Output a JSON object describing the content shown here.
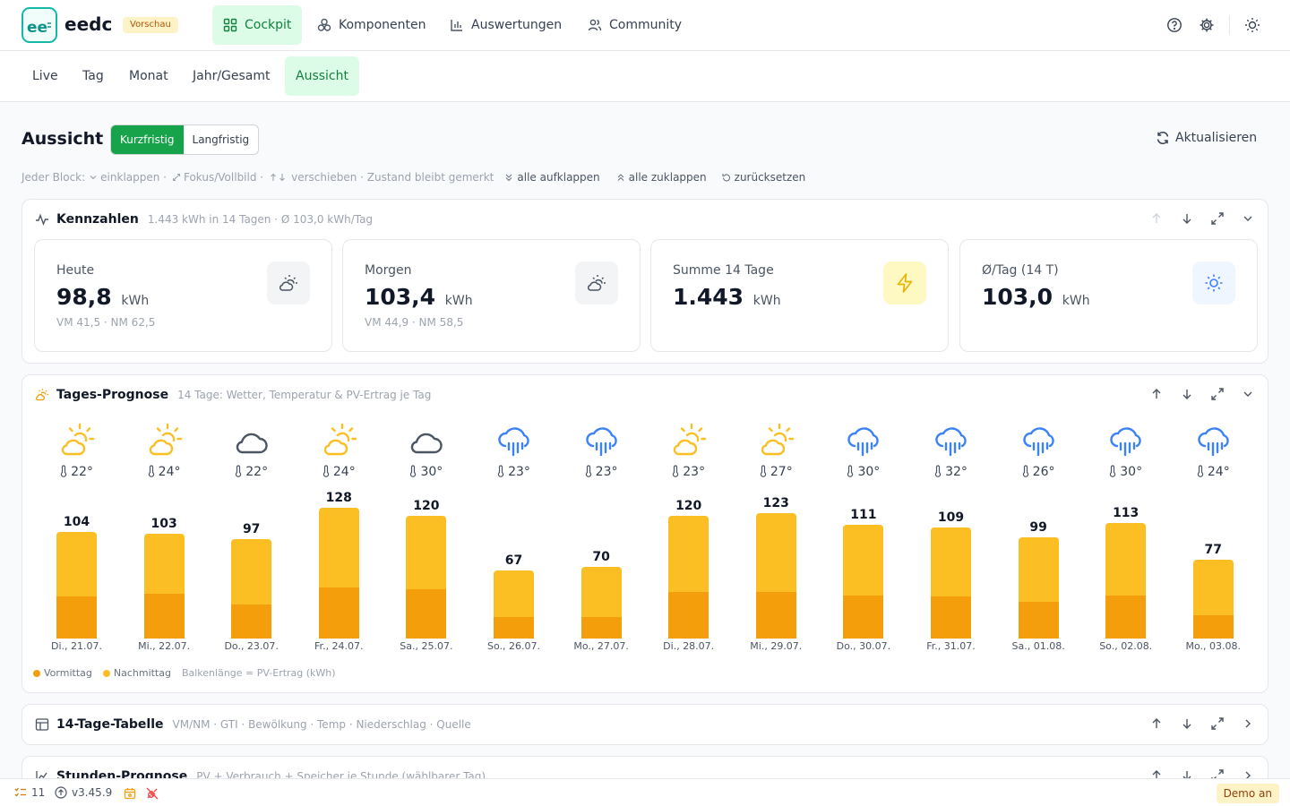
{
  "app": {
    "name": "eedc",
    "logo_text": "ee",
    "preview_badge": "Vorschau"
  },
  "nav": [
    {
      "label": "Cockpit",
      "active": true,
      "icon": "grid-icon"
    },
    {
      "label": "Komponenten",
      "active": false,
      "icon": "components-icon"
    },
    {
      "label": "Auswertungen",
      "active": false,
      "icon": "bar-chart-icon"
    },
    {
      "label": "Community",
      "active": false,
      "icon": "users-icon"
    }
  ],
  "subnav": [
    {
      "label": "Live",
      "active": false
    },
    {
      "label": "Tag",
      "active": false
    },
    {
      "label": "Monat",
      "active": false
    },
    {
      "label": "Jahr/Gesamt",
      "active": false
    },
    {
      "label": "Aussicht",
      "active": true
    }
  ],
  "page": {
    "title": "Aussicht",
    "segment": {
      "options": [
        "Kurzfristig",
        "Langfristig"
      ],
      "selected": "Kurzfristig"
    },
    "refresh_label": "Aktualisieren"
  },
  "hints": {
    "prefix": "Jeder Block:",
    "collapse": "einklappen ·",
    "focus": "Fokus/Vollbild ·",
    "move": "verschieben · Zustand bleibt gemerkt",
    "expand_all": "alle aufklappen",
    "collapse_all": "alle zuklappen",
    "reset": "zurücksetzen"
  },
  "kennzahlen": {
    "title": "Kennzahlen",
    "subtitle": "1.443 kWh in 14 Tagen · Ø 103,0 kWh/Tag",
    "cards": [
      {
        "label": "Heute",
        "value": "98,8",
        "unit": "kWh",
        "sub": "VM 41,5 · NM 62,5",
        "icon": "partly-cloudy-icon"
      },
      {
        "label": "Morgen",
        "value": "103,4",
        "unit": "kWh",
        "sub": "VM 44,9 · NM 58,5",
        "icon": "partly-cloudy-icon"
      },
      {
        "label": "Summe 14 Tage",
        "value": "1.443",
        "unit": "kWh",
        "sub": "",
        "icon": "lightning-icon"
      },
      {
        "label": "Ø/Tag (14 T)",
        "value": "103,0",
        "unit": "kWh",
        "sub": "",
        "icon": "sun-icon"
      }
    ]
  },
  "tages_prognose": {
    "title": "Tages-Prognose",
    "subtitle": "14 Tage: Wetter, Temperatur & PV-Ertrag je Tag",
    "legend": {
      "vm": "Vormittag",
      "nm": "Nachmittag",
      "note": "Balkenlänge = PV-Ertrag (kWh)"
    },
    "colors": {
      "vm": "#f59e0b",
      "nm": "#fbbf24"
    }
  },
  "chart_data": {
    "type": "bar",
    "categories": [
      "Di., 21.07.",
      "Mi., 22.07.",
      "Do., 23.07.",
      "Fr., 24.07.",
      "Sa., 25.07.",
      "So., 26.07.",
      "Mo., 27.07.",
      "Di., 28.07.",
      "Mi., 29.07.",
      "Do., 30.07.",
      "Fr., 31.07.",
      "Sa., 01.08.",
      "So., 02.08.",
      "Mo., 03.08."
    ],
    "totals": [
      104,
      103,
      97,
      128,
      120,
      67,
      70,
      120,
      123,
      111,
      109,
      99,
      113,
      77
    ],
    "series": [
      {
        "name": "Vormittag",
        "values": [
          41,
          44,
          33,
          50,
          48,
          21,
          21,
          46,
          46,
          42,
          41,
          36,
          42,
          23
        ]
      },
      {
        "name": "Nachmittag",
        "values": [
          63,
          59,
          64,
          78,
          72,
          46,
          49,
          74,
          77,
          69,
          68,
          63,
          71,
          54
        ]
      }
    ],
    "temperatures": [
      "22°",
      "24°",
      "22°",
      "24°",
      "30°",
      "23°",
      "23°",
      "23°",
      "27°",
      "30°",
      "32°",
      "26°",
      "30°",
      "24°"
    ],
    "weather": [
      "partly-cloudy-icon",
      "partly-cloudy-icon",
      "cloud-icon",
      "partly-cloudy-icon",
      "cloud-icon",
      "rain-icon",
      "rain-icon",
      "partly-cloudy-icon",
      "partly-cloudy-icon",
      "rain-icon",
      "rain-icon",
      "rain-icon",
      "rain-icon",
      "rain-icon"
    ],
    "ylabel": "",
    "ylim": [
      0,
      130
    ]
  },
  "tabelle": {
    "title": "14-Tage-Tabelle",
    "subtitle": "VM/NM · GTI · Bewölkung · Temp · Niederschlag · Quelle"
  },
  "stunden": {
    "title": "Stunden-Prognose",
    "subtitle": "PV + Verbrauch + Speicher je Stunde (wählbarer Tag)"
  },
  "statusbar": {
    "count": "11",
    "version": "v3.45.9",
    "demo": "Demo an"
  }
}
